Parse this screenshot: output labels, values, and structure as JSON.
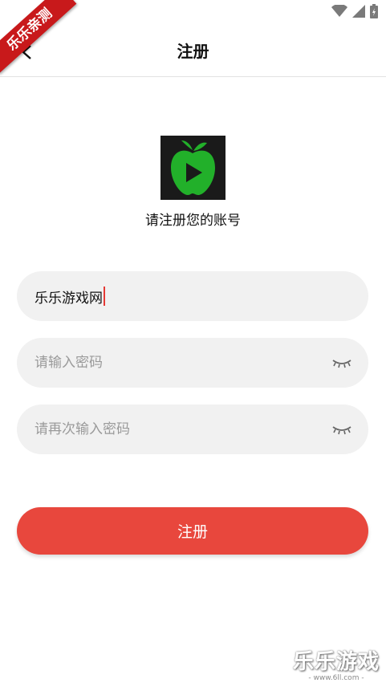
{
  "status_bar": {
    "icons": [
      "wifi-icon",
      "signal-icon",
      "battery-charging-icon"
    ]
  },
  "ribbon": {
    "text": "乐乐亲测"
  },
  "app_bar": {
    "title": "注册"
  },
  "logo": {
    "icon": "green-apple-play-icon"
  },
  "subtitle": "请注册您的账号",
  "form": {
    "username_value": "乐乐游戏网",
    "password_placeholder": "请输入密码",
    "confirm_placeholder": "请再次输入密码"
  },
  "submit_label": "注册",
  "watermark": {
    "text": "乐乐游戏",
    "url": "- www.6ll.com -"
  },
  "colors": {
    "accent": "#e8473d",
    "field_bg": "#f1f1f1",
    "ribbon": "#c8191b",
    "logo_green": "#22b02a"
  }
}
